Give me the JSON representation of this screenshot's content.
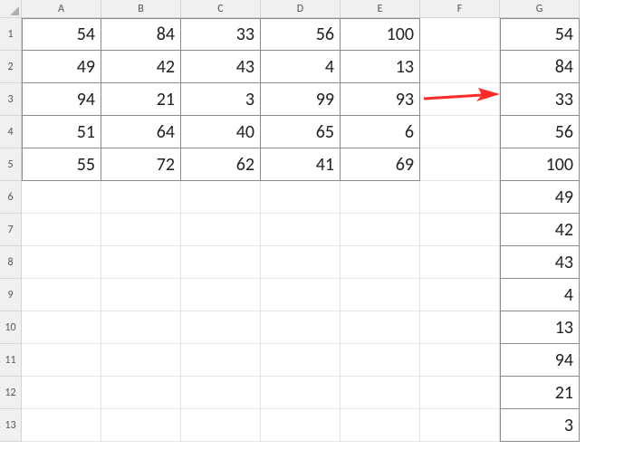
{
  "columns": [
    "A",
    "B",
    "C",
    "D",
    "E",
    "F",
    "G"
  ],
  "rows": [
    "1",
    "2",
    "3",
    "4",
    "5",
    "6",
    "7",
    "8",
    "9",
    "10",
    "11",
    "12",
    "13"
  ],
  "table": [
    [
      54,
      84,
      33,
      56,
      100
    ],
    [
      49,
      42,
      43,
      4,
      13
    ],
    [
      94,
      21,
      3,
      99,
      93
    ],
    [
      51,
      64,
      40,
      65,
      6
    ],
    [
      55,
      72,
      62,
      41,
      69
    ]
  ],
  "stacked": [
    54,
    84,
    33,
    56,
    100,
    49,
    42,
    43,
    4,
    13,
    94,
    21,
    3
  ],
  "arrow_color": "#ff2a2a"
}
